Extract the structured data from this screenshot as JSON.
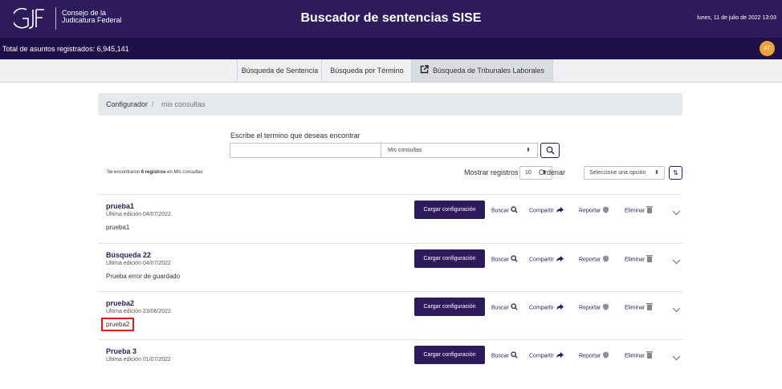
{
  "header": {
    "brand_line1": "Consejo de la",
    "brand_line2": "Judicatura Federal",
    "title": "Buscador de sentencias SISE",
    "date": "lunes, 11 de julio de 2022 13:03"
  },
  "subheader": {
    "total_label": "Total de asuntos registrados: 6,945,141",
    "avatar_initials": "AT"
  },
  "tabs": [
    {
      "label": "Búsqueda de Sentencia"
    },
    {
      "label": "Búsqueda por Término"
    },
    {
      "label": "Búsqueda de Tribunales Laborales",
      "icon": "external-link-icon"
    }
  ],
  "breadcrumb": {
    "root": "Configurador",
    "separator": "/",
    "current": "mis consultas"
  },
  "search": {
    "label": "Escribe el termino que deseas encontrar",
    "value": "",
    "scope_select": "Mis consultas"
  },
  "results": {
    "prefix": "Se encontraron ",
    "count_text": "6 registros",
    "middle": " en ",
    "scope": "Mis consultas",
    "show_label": "Mostrar registros",
    "page_size": "10",
    "order_label": "Ordenar",
    "order_placeholder": "Seleccione una opción"
  },
  "actions": {
    "load": "Cargar configuración",
    "search": "Buscar",
    "share": "Compartir",
    "report": "Reportar",
    "delete": "Eliminar"
  },
  "items": [
    {
      "title": "prueba1",
      "edited": "Última edición 04/07/2022",
      "description": "prueba1"
    },
    {
      "title": "Búsqueda 22",
      "edited": "Última edición 04/07/2022",
      "description": "Prueba error de guardado"
    },
    {
      "title": "prueba2",
      "edited": "Última edición 23/06/2022",
      "description": "prueba2",
      "highlighted": true
    },
    {
      "title": "Prueba 3",
      "edited": "Última edición 01/07/2022",
      "description": ""
    }
  ],
  "colors": {
    "primary": "#2d1b5c",
    "header_bg": "#2d1b5c",
    "subheader_bg": "#1f1147",
    "avatar": "#f0a13a",
    "highlight_box": "#e01818"
  }
}
